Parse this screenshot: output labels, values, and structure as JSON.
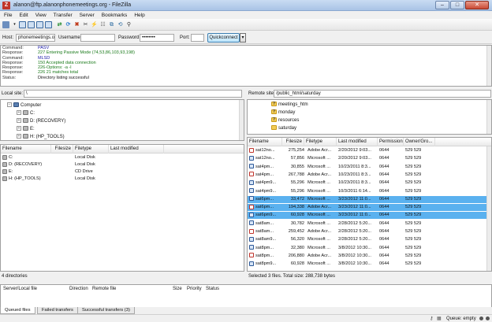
{
  "window": {
    "title": "alanon@ftp.alanonphonemeetings.org - FileZilla",
    "minimize": "–",
    "maximize": "□",
    "close": "✕"
  },
  "menu": [
    "File",
    "Edit",
    "View",
    "Transfer",
    "Server",
    "Bookmarks",
    "Help"
  ],
  "quickconnect": {
    "host_label": "Host:",
    "host_value": "phonemeetings.org",
    "user_label": "Username:",
    "user_value": "",
    "pass_label": "Password:",
    "pass_value": "••••••••",
    "port_label": "Port:",
    "port_value": "",
    "button": "Quickconnect",
    "dropdown": "▾"
  },
  "log": [
    {
      "k": "Command:",
      "v": "PASV",
      "color": "#1a1aa8"
    },
    {
      "k": "Response:",
      "v": "227 Entering Passive Mode (74,53,86,103,93,198)",
      "color": "#1a7a1a"
    },
    {
      "k": "Command:",
      "v": "MLSD",
      "color": "#1a1aa8"
    },
    {
      "k": "Response:",
      "v": "150 Accepted data connection",
      "color": "#1a7a1a"
    },
    {
      "k": "Response:",
      "v": "226-Options: -a -l",
      "color": "#1a7a1a"
    },
    {
      "k": "Response:",
      "v": "226 21 matches total",
      "color": "#1a7a1a"
    },
    {
      "k": "Status:",
      "v": "Directory listing successful",
      "color": "#111111"
    }
  ],
  "local": {
    "site_label": "Local site:",
    "site_value": "\\",
    "tree": [
      {
        "label": "Computer",
        "icon": "pc-icon",
        "indent": 0,
        "exp": "−"
      },
      {
        "label": "C:",
        "icon": "drive-icon",
        "indent": 1,
        "exp": "+"
      },
      {
        "label": "D: (RECOVERY)",
        "icon": "drive-icon",
        "indent": 1,
        "exp": "+"
      },
      {
        "label": "E:",
        "icon": "drive-icon",
        "indent": 1,
        "exp": "+"
      },
      {
        "label": "H: (HP_TOOLS)",
        "icon": "drive-icon",
        "indent": 1,
        "exp": "+"
      }
    ],
    "columns": [
      "Filename",
      "Filesize",
      "Filetype",
      "Last modified"
    ],
    "files": [
      {
        "name": "C:",
        "size": "",
        "type": "Local Disk",
        "modified": ""
      },
      {
        "name": "D: (RECOVERY)",
        "size": "",
        "type": "Local Disk",
        "modified": ""
      },
      {
        "name": "E:",
        "size": "",
        "type": "CD Drive",
        "modified": ""
      },
      {
        "name": "H: (HP_TOOLS)",
        "size": "",
        "type": "Local Disk",
        "modified": ""
      }
    ],
    "status": "4 directories"
  },
  "remote": {
    "site_label": "Remote site:",
    "site_value": "/public_html/saturday",
    "tree": [
      {
        "label": "meetings_htm",
        "icon": "unknown-folder-icon"
      },
      {
        "label": "monday",
        "icon": "unknown-folder-icon"
      },
      {
        "label": "resources",
        "icon": "unknown-folder-icon"
      },
      {
        "label": "saturday",
        "icon": "folder-icon"
      }
    ],
    "columns": [
      "Filename",
      "Filesize",
      "Filetype",
      "Last modified",
      "Permissions",
      "Owner/Gro..."
    ],
    "files": [
      {
        "name": "sat12no...",
        "size": "275,254",
        "type": "Adobe Acr...",
        "modified": "2/20/2012 9:03...",
        "perm": "0644",
        "owner": "529 529",
        "icon": "pdf",
        "selected": false
      },
      {
        "name": "sat12no...",
        "size": "57,856",
        "type": "Microsoft ...",
        "modified": "2/20/2012 9:03...",
        "perm": "0644",
        "owner": "529 529",
        "icon": "doc",
        "selected": false
      },
      {
        "name": "sat4pm...",
        "size": "30,855",
        "type": "Microsoft ...",
        "modified": "10/23/2011 8:3...",
        "perm": "0644",
        "owner": "529 529",
        "icon": "doc",
        "selected": false
      },
      {
        "name": "sat4pm...",
        "size": "267,788",
        "type": "Adobe Acr...",
        "modified": "10/23/2011 8:3...",
        "perm": "0644",
        "owner": "529 529",
        "icon": "pdf",
        "selected": false
      },
      {
        "name": "sat4pm9...",
        "size": "55,296",
        "type": "Microsoft ...",
        "modified": "10/23/2011 8:3...",
        "perm": "0644",
        "owner": "529 529",
        "icon": "doc",
        "selected": false
      },
      {
        "name": "sat4pm9...",
        "size": "55,296",
        "type": "Microsoft ...",
        "modified": "10/3/2011 6:14...",
        "perm": "0644",
        "owner": "529 529",
        "icon": "doc",
        "selected": false
      },
      {
        "name": "sat6pm...",
        "size": "33,472",
        "type": "Microsoft ...",
        "modified": "3/23/2012 11:0...",
        "perm": "0644",
        "owner": "529 529",
        "icon": "doc",
        "selected": true
      },
      {
        "name": "sat6pm...",
        "size": "194,338",
        "type": "Adobe Acr...",
        "modified": "3/23/2012 11:0...",
        "perm": "0644",
        "owner": "529 529",
        "icon": "pdf",
        "selected": true
      },
      {
        "name": "sat6pm9...",
        "size": "60,928",
        "type": "Microsoft ...",
        "modified": "3/23/2012 11:0...",
        "perm": "0644",
        "owner": "529 529",
        "icon": "doc",
        "selected": true
      },
      {
        "name": "sat8am...",
        "size": "30,782",
        "type": "Microsoft ...",
        "modified": "2/28/2012 5:20...",
        "perm": "0644",
        "owner": "529 529",
        "icon": "doc",
        "selected": false
      },
      {
        "name": "sat8am...",
        "size": "259,452",
        "type": "Adobe Acr...",
        "modified": "2/28/2012 5:20...",
        "perm": "0644",
        "owner": "529 529",
        "icon": "pdf",
        "selected": false
      },
      {
        "name": "sat8am9...",
        "size": "56,320",
        "type": "Microsoft ...",
        "modified": "2/28/2012 5:20...",
        "perm": "0644",
        "owner": "529 529",
        "icon": "doc",
        "selected": false
      },
      {
        "name": "sat8pm...",
        "size": "32,380",
        "type": "Microsoft ...",
        "modified": "3/8/2012 10:30...",
        "perm": "0644",
        "owner": "529 529",
        "icon": "doc",
        "selected": false
      },
      {
        "name": "sat8pm...",
        "size": "206,880",
        "type": "Adobe Acr...",
        "modified": "3/8/2012 10:30...",
        "perm": "0644",
        "owner": "529 529",
        "icon": "pdf",
        "selected": false
      },
      {
        "name": "sat8pm9...",
        "size": "60,928",
        "type": "Microsoft ...",
        "modified": "3/8/2012 10:30...",
        "perm": "0644",
        "owner": "529 529",
        "icon": "doc",
        "selected": false
      }
    ],
    "status": "Selected 3 files. Total size: 288,738 bytes"
  },
  "queue": {
    "columns": [
      "Server/Local file",
      "Direction",
      "Remote file",
      "Size",
      "Priority",
      "Status"
    ],
    "tabs": [
      "Queued files",
      "Failed transfers",
      "Successful transfers (3)"
    ]
  },
  "statusbar": {
    "queue": "Queue: empty"
  }
}
